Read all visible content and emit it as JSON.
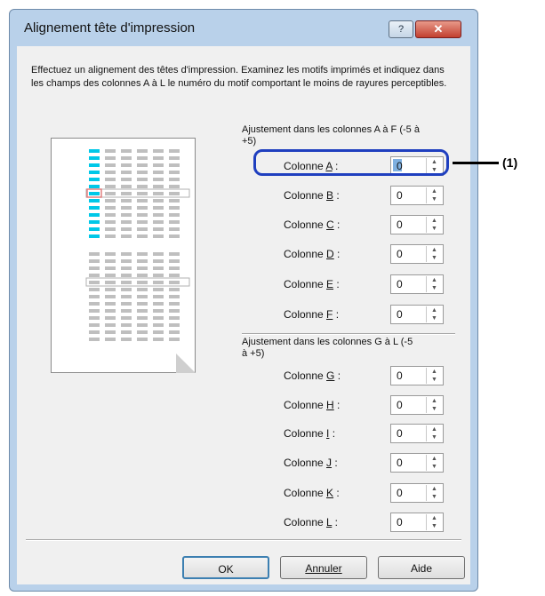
{
  "window": {
    "title": "Alignement tête d'impression",
    "help_button": "?",
    "close_button": "✕"
  },
  "intro_text": "Effectuez un alignement des têtes d'impression. Examinez les motifs imprimés et indiquez dans les champs des colonnes A à L le numéro du motif comportant le moins de rayures perceptibles.",
  "group_af": {
    "label": "Ajustement dans les colonnes A à F (-5 à +5)"
  },
  "group_gl": {
    "label": "Ajustement dans les colonnes G à L (-5 à +5)"
  },
  "columns": [
    {
      "prefix": "Colonne ",
      "letter": "A",
      "suffix": " :",
      "value": "0"
    },
    {
      "prefix": "Colonne ",
      "letter": "B",
      "suffix": " :",
      "value": "0"
    },
    {
      "prefix": "Colonne ",
      "letter": "C",
      "suffix": " :",
      "value": "0"
    },
    {
      "prefix": "Colonne ",
      "letter": "D",
      "suffix": " :",
      "value": "0"
    },
    {
      "prefix": "Colonne ",
      "letter": "E",
      "suffix": " :",
      "value": "0"
    },
    {
      "prefix": "Colonne ",
      "letter": "F",
      "suffix": " :",
      "value": "0"
    },
    {
      "prefix": "Colonne ",
      "letter": "G",
      "suffix": " :",
      "value": "0"
    },
    {
      "prefix": "Colonne ",
      "letter": "H",
      "suffix": " :",
      "value": "0"
    },
    {
      "prefix": "Colonne ",
      "letter": "I",
      "suffix": " :",
      "value": "0"
    },
    {
      "prefix": "Colonne ",
      "letter": "J",
      "suffix": " :",
      "value": "0"
    },
    {
      "prefix": "Colonne ",
      "letter": "K",
      "suffix": " :",
      "value": "0"
    },
    {
      "prefix": "Colonne ",
      "letter": "L",
      "suffix": " :",
      "value": "0"
    }
  ],
  "callout": {
    "label": "(1)"
  },
  "buttons": {
    "ok": "OK",
    "cancel": "Annuler",
    "help": "Aide"
  },
  "colors": {
    "pattern_accent": "#00c8e8",
    "highlight_border": "#1f3fbf",
    "selection_box": "#e08080"
  }
}
